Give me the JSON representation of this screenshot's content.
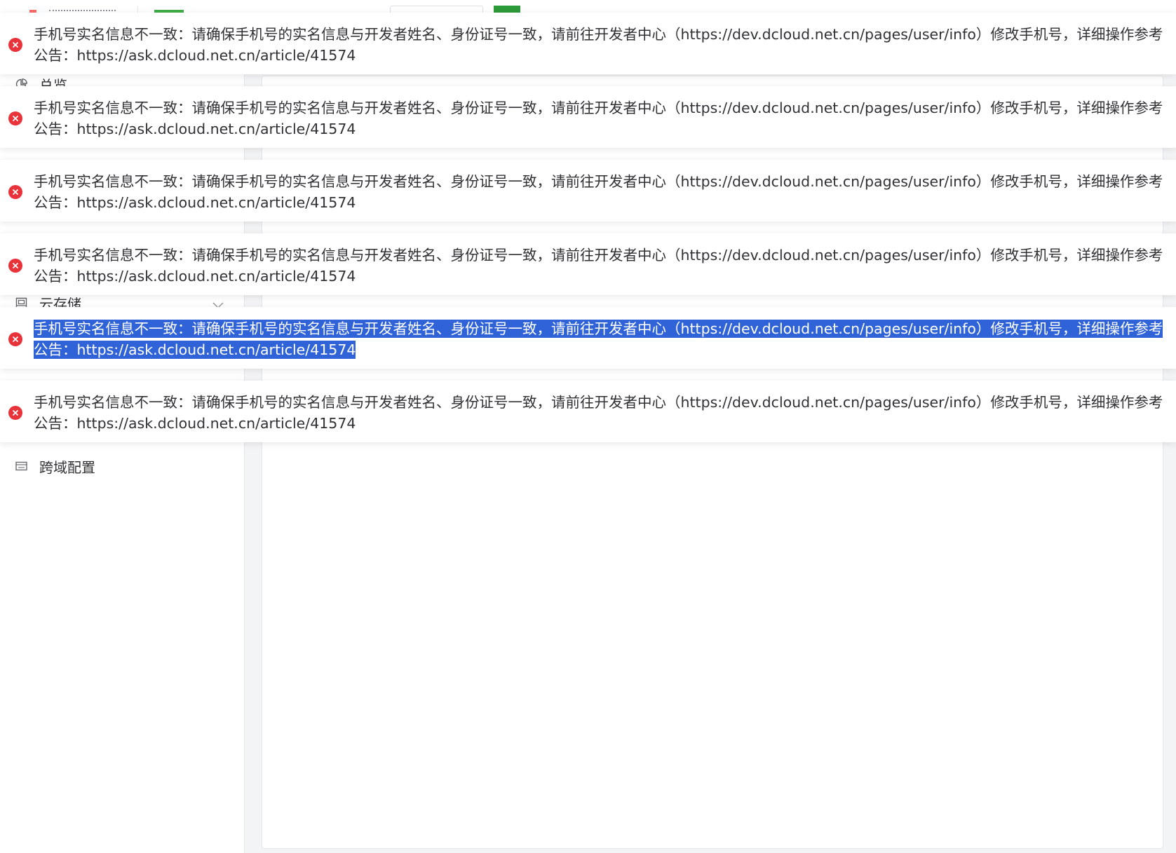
{
  "sidebar": {
    "items": [
      {
        "label": "总览",
        "icon": "pie-chart-icon"
      },
      {
        "label": "云存储",
        "icon": "storage-icon",
        "expandable": true
      },
      {
        "label": "跨域配置",
        "icon": "cross-domain-icon"
      }
    ]
  },
  "notifications": [
    {
      "type": "error",
      "icon": "error-circle-icon",
      "message": "手机号实名信息不一致：请确保手机号的实名信息与开发者姓名、身份证号一致，请前往开发者中心（https://dev.dcloud.net.cn/pages/user/info）修改手机号，详细操作参考公告：https://ask.dcloud.net.cn/article/41574",
      "selected": false
    },
    {
      "type": "error",
      "icon": "error-circle-icon",
      "message": "手机号实名信息不一致：请确保手机号的实名信息与开发者姓名、身份证号一致，请前往开发者中心（https://dev.dcloud.net.cn/pages/user/info）修改手机号，详细操作参考公告：https://ask.dcloud.net.cn/article/41574",
      "selected": false
    },
    {
      "type": "error",
      "icon": "error-circle-icon",
      "message": "手机号实名信息不一致：请确保手机号的实名信息与开发者姓名、身份证号一致，请前往开发者中心（https://dev.dcloud.net.cn/pages/user/info）修改手机号，详细操作参考公告：https://ask.dcloud.net.cn/article/41574",
      "selected": false
    },
    {
      "type": "error",
      "icon": "error-circle-icon",
      "message": "手机号实名信息不一致：请确保手机号的实名信息与开发者姓名、身份证号一致，请前往开发者中心（https://dev.dcloud.net.cn/pages/user/info）修改手机号，详细操作参考公告：https://ask.dcloud.net.cn/article/41574",
      "selected": false
    },
    {
      "type": "error",
      "icon": "error-circle-icon",
      "message": "手机号实名信息不一致：请确保手机号的实名信息与开发者姓名、身份证号一致，请前往开发者中心（https://dev.dcloud.net.cn/pages/user/info）修改手机号，详细操作参考公告：https://ask.dcloud.net.cn/article/41574",
      "selected": true
    },
    {
      "type": "error",
      "icon": "error-circle-icon",
      "message": "手机号实名信息不一致：请确保手机号的实名信息与开发者姓名、身份证号一致，请前往开发者中心（https://dev.dcloud.net.cn/pages/user/info）修改手机号，详细操作参考公告：https://ask.dcloud.net.cn/article/41574",
      "selected": false
    }
  ],
  "colors": {
    "error": "#e8333a",
    "selection": "#2f63d7",
    "text": "#303133",
    "background": "#f3f4f6"
  }
}
